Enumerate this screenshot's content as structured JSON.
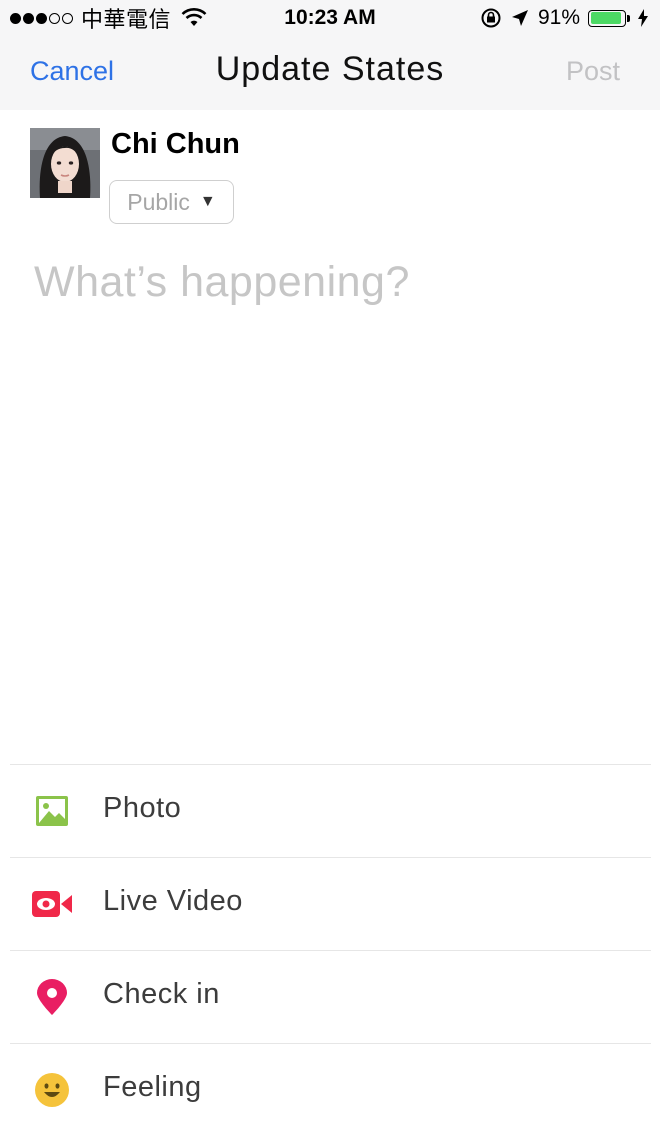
{
  "status_bar": {
    "carrier": "中華電信",
    "time": "10:23 AM",
    "battery_percent": "91%",
    "battery_level": 0.91,
    "icons": [
      "signal-dots-icon",
      "wifi-icon",
      "rotation-lock-icon",
      "location-arrow-icon",
      "battery-icon",
      "charging-bolt-icon"
    ]
  },
  "nav": {
    "cancel_label": "Cancel",
    "title": "Update States",
    "post_label": "Post"
  },
  "user": {
    "name": "Chi Chun",
    "privacy": "Public"
  },
  "composer": {
    "placeholder": "What’s happening?"
  },
  "actions": [
    {
      "label": "Photo",
      "icon": "photo-icon",
      "color": "#8bc34a"
    },
    {
      "label": "Live Video",
      "icon": "live-video-icon",
      "color": "#f02849"
    },
    {
      "label": "Check in",
      "icon": "location-pin-icon",
      "color": "#e91e63"
    },
    {
      "label": "Feeling",
      "icon": "smiley-icon",
      "color": "#f5c33b"
    }
  ],
  "colors": {
    "accent": "#2e72e6",
    "disabled": "#c2c2c4",
    "battery": "#4cd964"
  }
}
